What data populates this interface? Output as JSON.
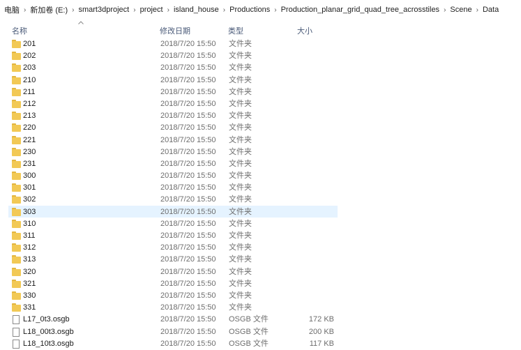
{
  "breadcrumb": [
    "电脑",
    "新加卷 (E:)",
    "smart3dproject",
    "project",
    "island_house",
    "Productions",
    "Production_planar_grid_quad_tree_acrosstiles",
    "Scene",
    "Data"
  ],
  "columns": {
    "name": "名称",
    "date": "修改日期",
    "type": "类型",
    "size": "大小"
  },
  "rows": [
    {
      "name": "201",
      "date": "2018/7/20 15:50",
      "type": "文件夹",
      "size": "",
      "icon": "folder-icon"
    },
    {
      "name": "202",
      "date": "2018/7/20 15:50",
      "type": "文件夹",
      "size": "",
      "icon": "folder-icon"
    },
    {
      "name": "203",
      "date": "2018/7/20 15:50",
      "type": "文件夹",
      "size": "",
      "icon": "folder-icon"
    },
    {
      "name": "210",
      "date": "2018/7/20 15:50",
      "type": "文件夹",
      "size": "",
      "icon": "folder-icon"
    },
    {
      "name": "211",
      "date": "2018/7/20 15:50",
      "type": "文件夹",
      "size": "",
      "icon": "folder-icon"
    },
    {
      "name": "212",
      "date": "2018/7/20 15:50",
      "type": "文件夹",
      "size": "",
      "icon": "folder-icon"
    },
    {
      "name": "213",
      "date": "2018/7/20 15:50",
      "type": "文件夹",
      "size": "",
      "icon": "folder-icon"
    },
    {
      "name": "220",
      "date": "2018/7/20 15:50",
      "type": "文件夹",
      "size": "",
      "icon": "folder-icon"
    },
    {
      "name": "221",
      "date": "2018/7/20 15:50",
      "type": "文件夹",
      "size": "",
      "icon": "folder-icon"
    },
    {
      "name": "230",
      "date": "2018/7/20 15:50",
      "type": "文件夹",
      "size": "",
      "icon": "folder-icon"
    },
    {
      "name": "231",
      "date": "2018/7/20 15:50",
      "type": "文件夹",
      "size": "",
      "icon": "folder-icon"
    },
    {
      "name": "300",
      "date": "2018/7/20 15:50",
      "type": "文件夹",
      "size": "",
      "icon": "folder-icon"
    },
    {
      "name": "301",
      "date": "2018/7/20 15:50",
      "type": "文件夹",
      "size": "",
      "icon": "folder-icon"
    },
    {
      "name": "302",
      "date": "2018/7/20 15:50",
      "type": "文件夹",
      "size": "",
      "icon": "folder-icon"
    },
    {
      "name": "303",
      "date": "2018/7/20 15:50",
      "type": "文件夹",
      "size": "",
      "icon": "folder-icon",
      "selected": true
    },
    {
      "name": "310",
      "date": "2018/7/20 15:50",
      "type": "文件夹",
      "size": "",
      "icon": "folder-icon"
    },
    {
      "name": "311",
      "date": "2018/7/20 15:50",
      "type": "文件夹",
      "size": "",
      "icon": "folder-icon"
    },
    {
      "name": "312",
      "date": "2018/7/20 15:50",
      "type": "文件夹",
      "size": "",
      "icon": "folder-icon"
    },
    {
      "name": "313",
      "date": "2018/7/20 15:50",
      "type": "文件夹",
      "size": "",
      "icon": "folder-icon"
    },
    {
      "name": "320",
      "date": "2018/7/20 15:50",
      "type": "文件夹",
      "size": "",
      "icon": "folder-icon"
    },
    {
      "name": "321",
      "date": "2018/7/20 15:50",
      "type": "文件夹",
      "size": "",
      "icon": "folder-icon"
    },
    {
      "name": "330",
      "date": "2018/7/20 15:50",
      "type": "文件夹",
      "size": "",
      "icon": "folder-icon"
    },
    {
      "name": "331",
      "date": "2018/7/20 15:50",
      "type": "文件夹",
      "size": "",
      "icon": "folder-icon"
    },
    {
      "name": "L17_0t3.osgb",
      "date": "2018/7/20 15:50",
      "type": "OSGB 文件",
      "size": "172 KB",
      "icon": "file-icon"
    },
    {
      "name": "L18_00t3.osgb",
      "date": "2018/7/20 15:50",
      "type": "OSGB 文件",
      "size": "200 KB",
      "icon": "file-icon"
    },
    {
      "name": "L18_10t3.osgb",
      "date": "2018/7/20 15:50",
      "type": "OSGB 文件",
      "size": "117 KB",
      "icon": "file-icon"
    }
  ],
  "colors": {
    "selected_row": "#e5f3ff",
    "header_text": "#4a5a78",
    "folder": "#f2c955"
  }
}
